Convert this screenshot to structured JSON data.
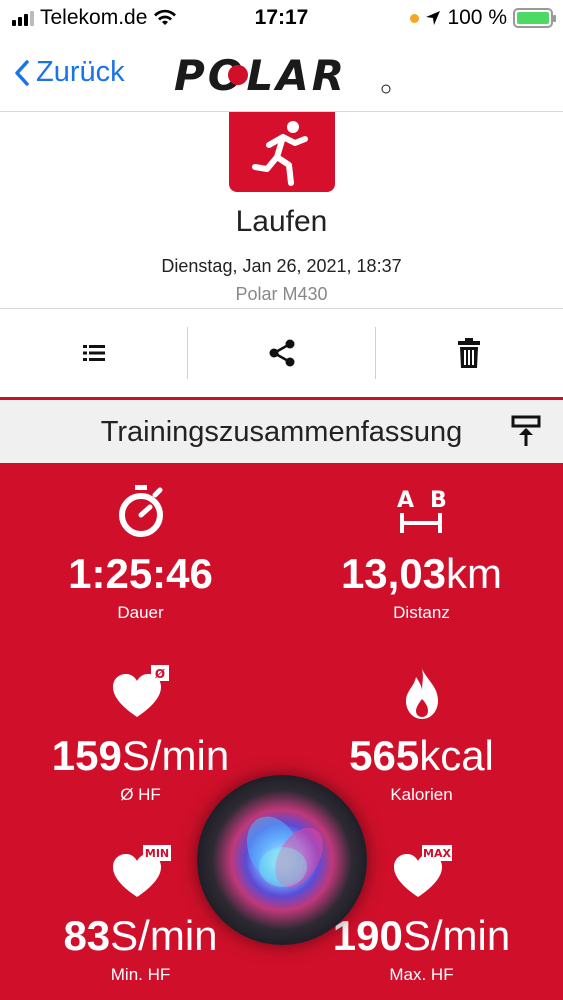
{
  "status_bar": {
    "carrier": "Telekom.de",
    "time": "17:17",
    "battery": "100 %"
  },
  "nav": {
    "back_label": "Zurück",
    "logo_text": "POLAR"
  },
  "session": {
    "sport": "Laufen",
    "date": "Dienstag, Jan 26, 2021, 18:37",
    "device": "Polar M430"
  },
  "toolbar": {
    "icons": [
      "list-icon",
      "share-icon",
      "trash-icon"
    ]
  },
  "summary": {
    "title": "Trainingszusammenfassung",
    "stats": [
      {
        "value": "1:25:46",
        "unit": "",
        "label": "Dauer",
        "icon": "stopwatch-icon"
      },
      {
        "value": "13,03",
        "unit": "km",
        "label": "Distanz",
        "icon": "distance-ab-icon",
        "icon_text_a": "A",
        "icon_text_b": "B"
      },
      {
        "value": "159",
        "unit": "S/min",
        "label": "Ø HF",
        "icon": "heart-avg-icon",
        "badge": "Ø"
      },
      {
        "value": "565",
        "unit": "kcal",
        "label": "Kalorien",
        "icon": "flame-icon"
      },
      {
        "value": "83",
        "unit": "S/min",
        "label": "Min. HF",
        "icon": "heart-min-icon",
        "badge": "MIN"
      },
      {
        "value": "190",
        "unit": "S/min",
        "label": "Max. HF",
        "icon": "heart-max-icon",
        "badge": "MAX"
      }
    ]
  },
  "colors": {
    "polar_red": "#d0102a",
    "link_blue": "#1a73e8"
  }
}
